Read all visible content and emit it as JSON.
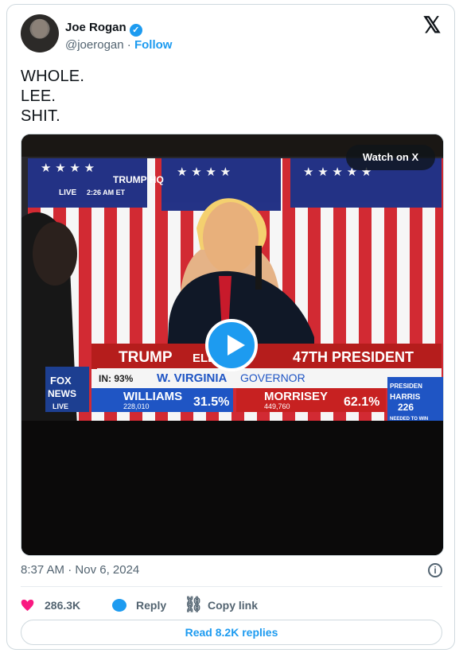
{
  "author": {
    "name": "Joe Rogan",
    "verified_badge": "✓",
    "handle": "@joerogan",
    "separator": "·",
    "follow_label": "Follow"
  },
  "x_logo": "𝕏",
  "post": {
    "lines": [
      "WHOLE.",
      "LEE.",
      "SHIT."
    ]
  },
  "media": {
    "watch_label": "Watch on X",
    "video_text": {
      "network_badge": "TRUMP HQ",
      "live_label": "LIVE",
      "live_time": "2:26 AM ET",
      "fox_top": "FOX",
      "fox_bottom": "NEWS",
      "fox_live": "LIVE",
      "headline_left": "TRUMP",
      "headline_mid": "ELECTED",
      "headline_right": "47TH PRESIDENT",
      "reporting": "IN: 93%",
      "race_title": "W. VIRGINIA",
      "race_office": "GOVERNOR",
      "candidate_1_name": "WILLIAMS",
      "candidate_1_votes": "228,010",
      "candidate_1_pct": "31.5%",
      "candidate_2_name": "MORRISEY",
      "candidate_2_votes": "449,760",
      "candidate_2_pct": "62.1%",
      "side_heading": "PRESIDEN",
      "side_name": "HARRIS",
      "side_value": "226",
      "side_note": "NEEDED TO WIN"
    }
  },
  "meta": {
    "time": "8:37 AM",
    "date_separator": "·",
    "date": "Nov 6, 2024",
    "info_icon_glyph": "i"
  },
  "actions": {
    "likes": "286.3K",
    "reply": "Reply",
    "copy_link": "Copy link"
  },
  "read_replies": "Read 8.2K replies",
  "colors": {
    "accent": "#1d9bf0",
    "like": "#f91880",
    "text": "#0f1419",
    "muted": "#536471",
    "border": "#cfd9de"
  }
}
